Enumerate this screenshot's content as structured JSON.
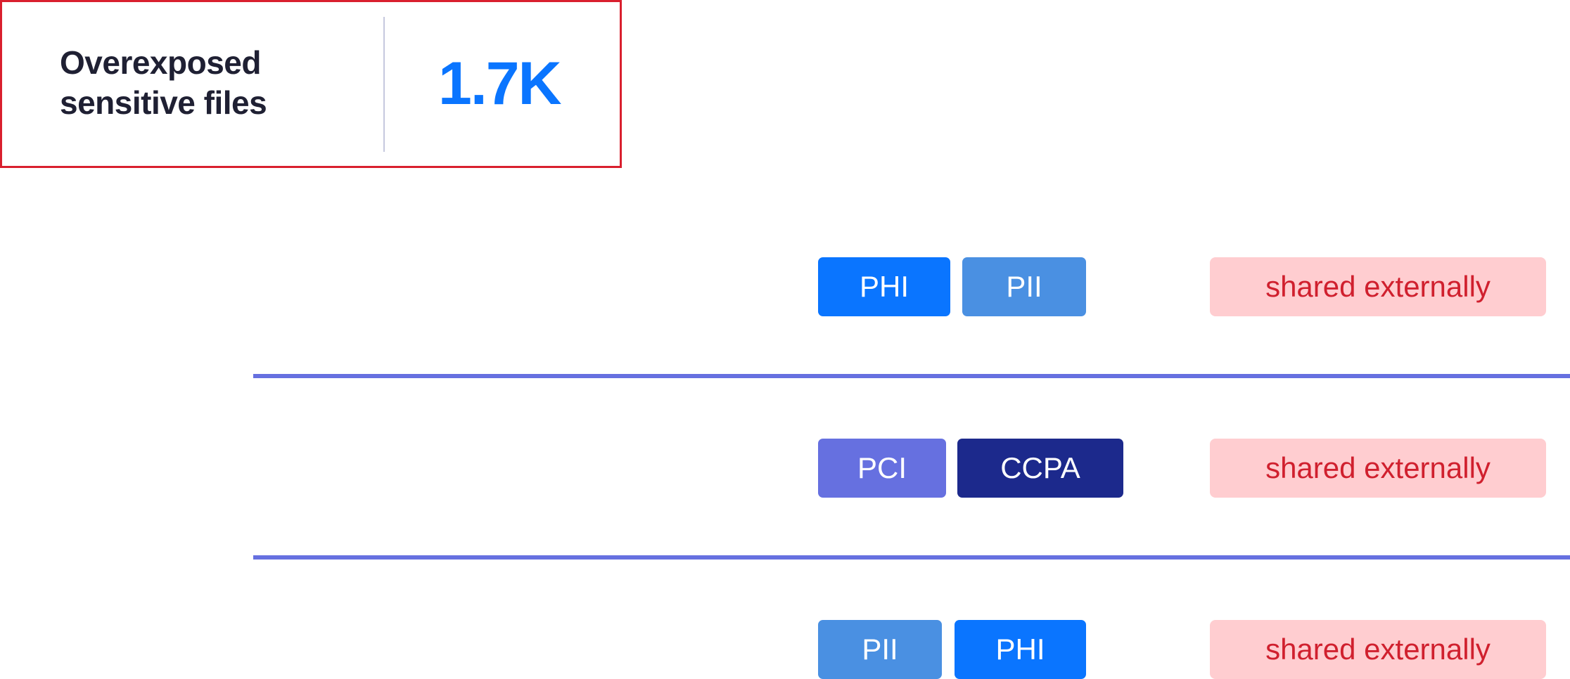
{
  "summary_card": {
    "title_line1": "Overexposed",
    "title_line2": "sensitive files",
    "value": "1.7K",
    "border_color": "#D91F2E",
    "value_color": "#0A75FF"
  },
  "colors": {
    "PHI": "#0A75FF",
    "PII": "#4A90E2",
    "PCI": "#6670E0",
    "CCPA": "#1C298C",
    "separator": "#6670E0",
    "exposure_badge_bg": "#FFCDD0",
    "exposure_badge_text": "#D0202E"
  },
  "rows": [
    {
      "tags": [
        "PHI",
        "PII"
      ],
      "status": "shared externally"
    },
    {
      "tags": [
        "PCI",
        "CCPA"
      ],
      "status": "shared externally"
    },
    {
      "tags": [
        "PII",
        "PHI"
      ],
      "status": "shared externally"
    }
  ]
}
